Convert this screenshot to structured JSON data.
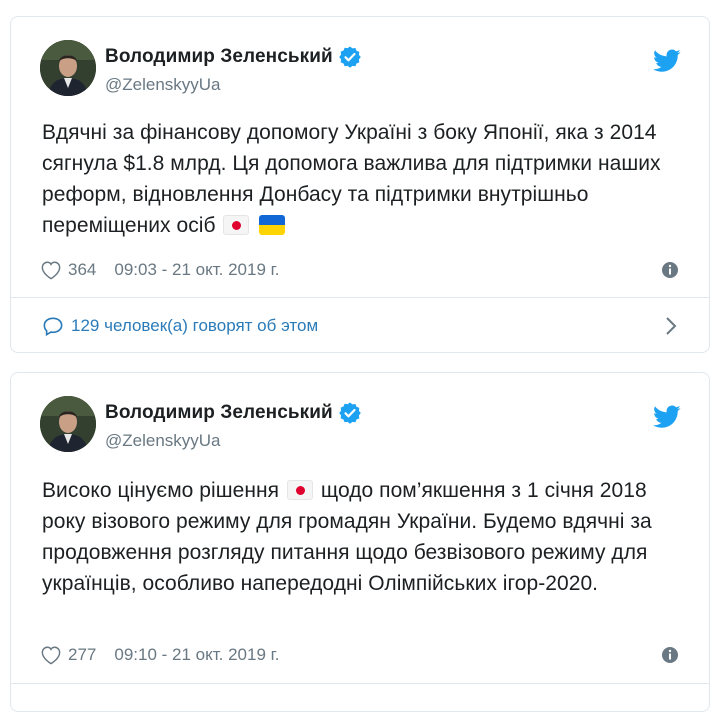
{
  "tweets": [
    {
      "author": "Володимир Зеленський",
      "handle": "@ZelenskyyUa",
      "text_part1": "Вдячні за фінансову допомогу Україні з боку Японії, яка з 2014 сягнула $1.8 млрд. Ця допомога важлива для підтримки наших реформ, відновлення Донбасу та підтримки внутрішньо переміщених осіб",
      "likes": "364",
      "timestamp": "09:03 - 21 окт. 2019 г.",
      "discussion": "129 человек(а) говорят об этом"
    },
    {
      "author": "Володимир Зеленський",
      "handle": "@ZelenskyyUa",
      "text_part1": "Високо цінуємо рішення",
      "text_part2": "щодо пом’якшення з 1 січня 2018 року візового режиму для громадян України. Будемо вдячні за продовження розгляду питання щодо безвізового режиму для українців, особливо напередодні Олімпійських ігор-2020.",
      "likes": "277",
      "timestamp": "09:10 - 21 окт. 2019 г."
    }
  ],
  "icons": {
    "verified": "verified-badge-icon",
    "brand": "twitter-bird-icon",
    "like": "heart-icon",
    "info": "info-icon",
    "reply": "speech-bubble-icon",
    "more": "chevron-right-icon",
    "flag_japan": "japan-flag-emoji",
    "flag_ukraine": "ukraine-flag-emoji"
  },
  "colors": {
    "brand": "#1da1f2",
    "link": "#2b7bb9",
    "muted": "#697882",
    "text": "#1c2022",
    "border": "#e1e8ed"
  }
}
